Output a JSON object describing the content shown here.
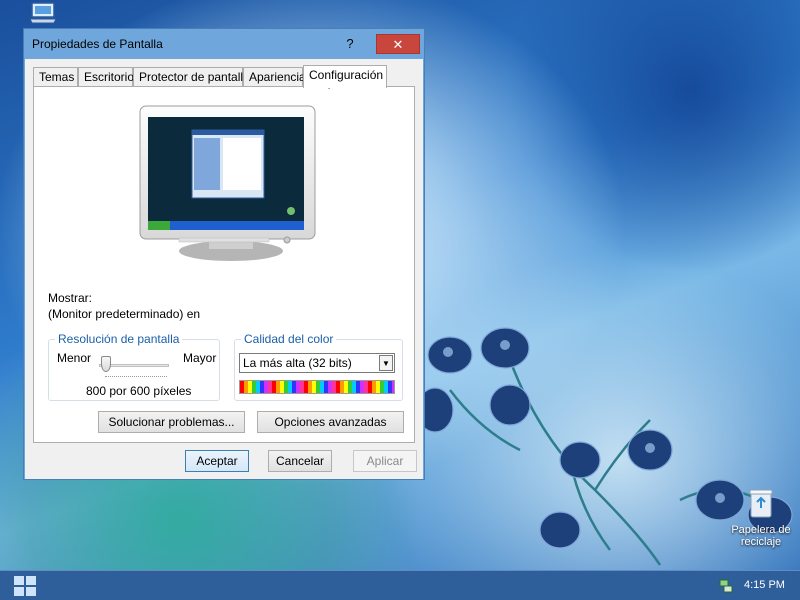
{
  "window": {
    "title": "Propiedades de Pantalla",
    "help_label": "?",
    "close_label": "✕"
  },
  "tabs": [
    {
      "label": "Temas",
      "active": false
    },
    {
      "label": "Escritorio",
      "active": false
    },
    {
      "label": "Protector de pantalla",
      "active": false
    },
    {
      "label": "Apariencia",
      "active": false
    },
    {
      "label": "Configuración",
      "active": true
    }
  ],
  "settings": {
    "display_label": "Mostrar:",
    "display_value": "(Monitor predeterminado) en",
    "resolution": {
      "group_title": "Resolución de pantalla",
      "less_label": "Menor",
      "more_label": "Mayor",
      "value_label": "800 por 600 píxeles"
    },
    "color": {
      "group_title": "Calidad del color",
      "selected": "La más alta (32 bits)"
    },
    "troubleshoot_label": "Solucionar problemas...",
    "advanced_label": "Opciones avanzadas"
  },
  "footer": {
    "ok_label": "Aceptar",
    "cancel_label": "Cancelar",
    "apply_label": "Aplicar"
  },
  "desktop": {
    "recycle_bin_label": "Papelera de reciclaje"
  },
  "taskbar": {
    "clock": "4:15 PM"
  },
  "icons": {
    "start": "windows-logo-icon",
    "tray": "network-icon",
    "recycle": "recycle-bin-icon",
    "desktop_top": "computer-icon"
  },
  "colors": {
    "titlebar": "#6fa7dc",
    "close": "#c9463d",
    "taskbar": "#2f5f9a",
    "group_title": "#1b5fa8"
  }
}
